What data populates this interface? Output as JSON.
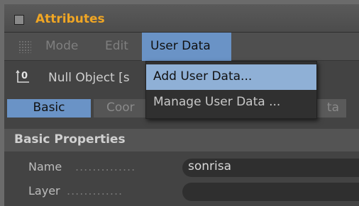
{
  "window": {
    "title": "Attributes"
  },
  "menubar": {
    "items": [
      {
        "label": "Mode"
      },
      {
        "label": "Edit"
      },
      {
        "label": "User Data"
      }
    ]
  },
  "object": {
    "label": "Null Object [s"
  },
  "tabs": [
    {
      "label": "Basic",
      "active": true
    },
    {
      "label": "Coor"
    },
    {
      "label": ""
    },
    {
      "label": "ta"
    }
  ],
  "section": {
    "title": "Basic Properties"
  },
  "properties": [
    {
      "label": "Name",
      "dots": "..............",
      "value": "sonrisa"
    },
    {
      "label": "Layer",
      "dots": ".............",
      "value": ""
    }
  ],
  "dropdown": {
    "items": [
      {
        "label": "Add User Data...",
        "highlighted": true
      },
      {
        "label": "Manage User Data ..."
      }
    ]
  },
  "colors": {
    "accent": "#f0a624",
    "selection": "#6a93c6",
    "hover": "#8fb0d6"
  }
}
